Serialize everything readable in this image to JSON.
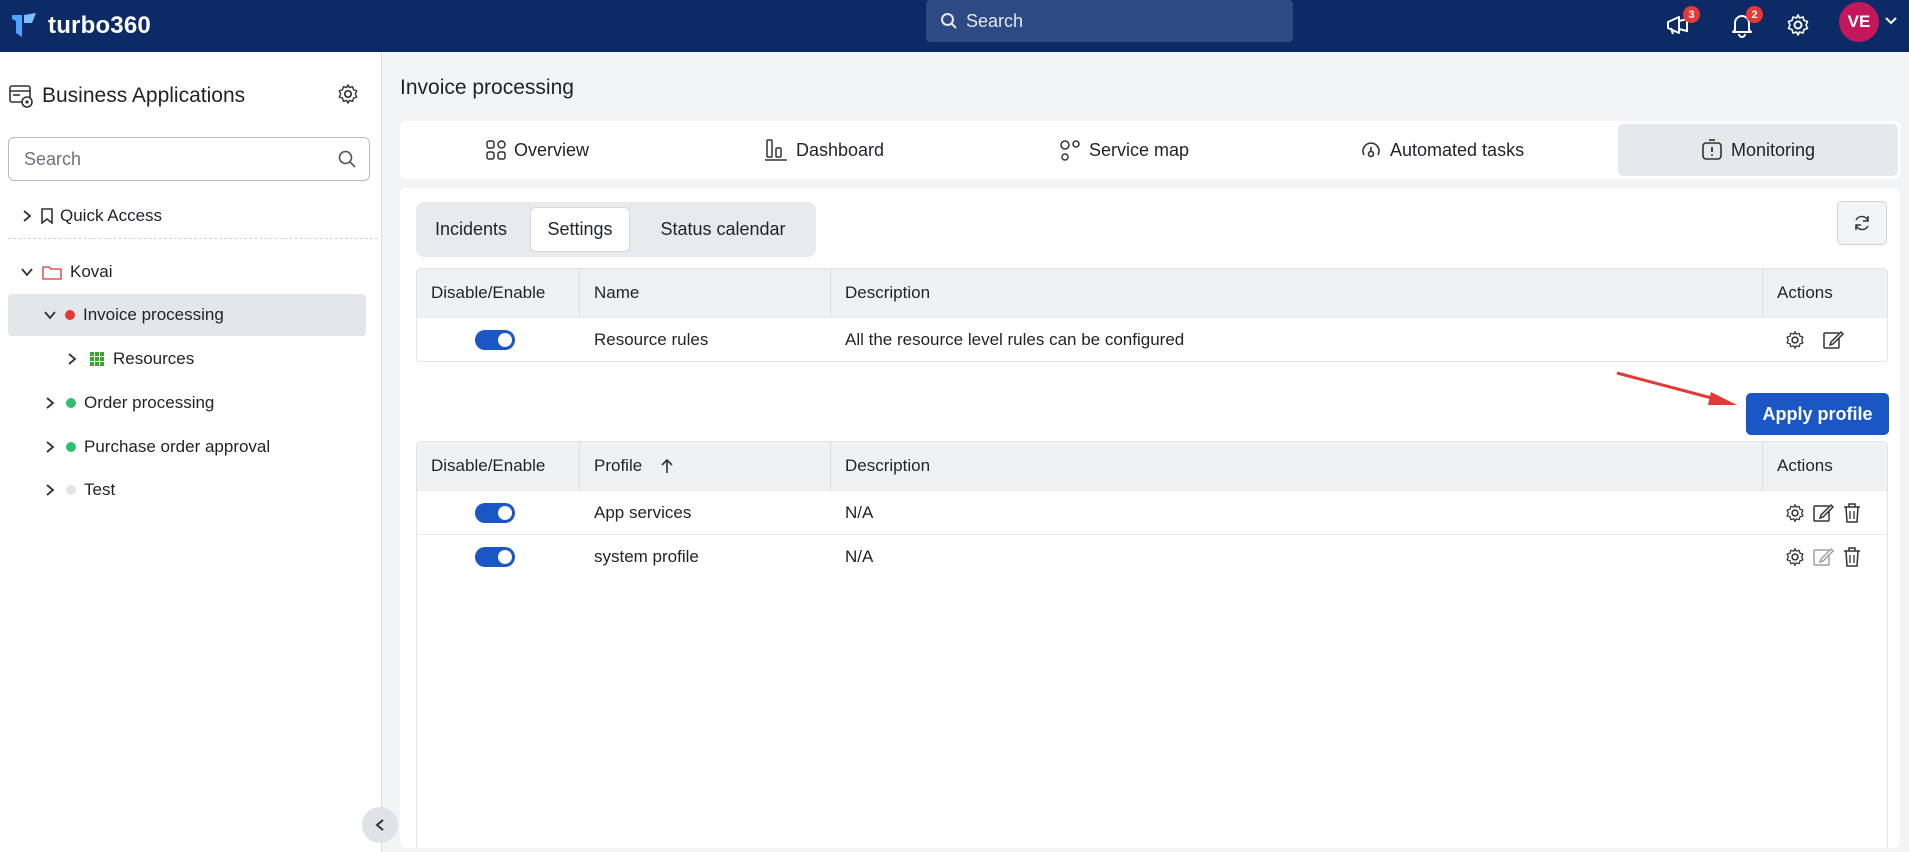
{
  "topbar": {
    "brand": "turbo360",
    "search_placeholder": "Search",
    "announcements_count": "3",
    "notifications_count": "2",
    "avatar_initials": "VE"
  },
  "sidebar": {
    "title": "Business Applications",
    "search_placeholder": "Search",
    "quick_access": "Quick Access",
    "folder": "Kovai",
    "items": [
      {
        "label": "Invoice processing",
        "status_color": "#e53935",
        "active": true
      },
      {
        "label": "Resources"
      },
      {
        "label": "Order processing",
        "status_color": "#2fbf71"
      },
      {
        "label": "Purchase order approval",
        "status_color": "#2fbf71"
      },
      {
        "label": "Test",
        "status_color": "#e3e5e8"
      }
    ]
  },
  "main": {
    "page_title": "Invoice processing",
    "tabs": [
      {
        "label": "Overview",
        "icon": "overview-icon"
      },
      {
        "label": "Dashboard",
        "icon": "dashboard-icon"
      },
      {
        "label": "Service map",
        "icon": "service-map-icon"
      },
      {
        "label": "Automated tasks",
        "icon": "automated-tasks-icon"
      },
      {
        "label": "Monitoring",
        "icon": "monitoring-icon",
        "active": true
      }
    ],
    "subtabs": [
      {
        "label": "Incidents"
      },
      {
        "label": "Settings",
        "active": true
      },
      {
        "label": "Status calendar"
      }
    ],
    "rules_table": {
      "headers": [
        "Disable/Enable",
        "Name",
        "Description",
        "Actions"
      ],
      "rows": [
        {
          "enabled": true,
          "name": "Resource rules",
          "description": "All the resource level rules can be configured"
        }
      ]
    },
    "apply_profile_label": "Apply profile",
    "profiles_table": {
      "headers": [
        "Disable/Enable",
        "Profile",
        "Description",
        "Actions"
      ],
      "rows": [
        {
          "enabled": true,
          "name": "App services",
          "description": "N/A"
        },
        {
          "enabled": true,
          "name": "system profile",
          "description": "N/A"
        }
      ]
    }
  },
  "colors": {
    "topbar": "#0b2a66",
    "primary": "#1a56c4",
    "annotation_arrow": "#e53935"
  }
}
